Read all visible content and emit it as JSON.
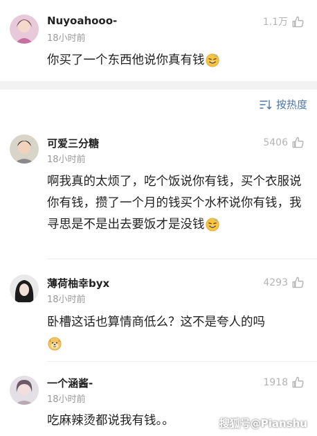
{
  "comments": [
    {
      "name": "Nuyoahooo-",
      "time": "18小时前",
      "likes": "1.1万",
      "text": "你买了一个东西他说你真有钱",
      "emoji": "sweat-smile-emoji"
    },
    {
      "name": "可爱三分糖",
      "time": "18小时前",
      "likes": "5406",
      "text": "啊我真的太烦了，吃个饭说你有钱，买个衣服说你有钱，攒了一个月的钱买个水杯说你有钱，我寻思是不是出去要饭才是没钱",
      "emoji": "sweat-smile-emoji"
    },
    {
      "name": "薄荷柚幸byx",
      "time": "18小时前",
      "likes": "4293",
      "text": "卧槽这话也算情商低么？这不是夸人的吗",
      "emoji": "doge-emoji"
    },
    {
      "name": "一个涵酱-",
      "time": "18小时前",
      "likes": "1918",
      "text": "吃麻辣烫都说我有钱。。",
      "emoji": ""
    }
  ],
  "sort": {
    "label": "按热度",
    "icon": "sort-lines-icon"
  },
  "watermark": "搜狐号@Pianshu",
  "icons": {
    "like": "thumbs-up-icon"
  },
  "colors": {
    "accent": "#4a76a8",
    "muted": "#9a9a9a",
    "like": "#b4b4b4"
  }
}
